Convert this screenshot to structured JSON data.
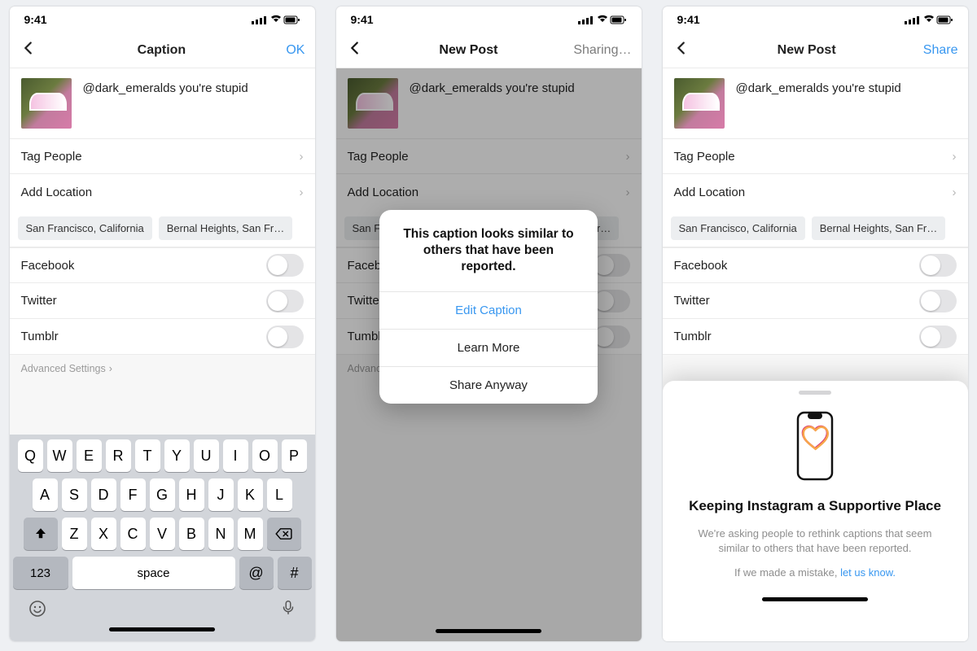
{
  "status": {
    "time": "9:41"
  },
  "s1": {
    "title": "Caption",
    "action": "OK",
    "caption": "@dark_emeralds you're stupid",
    "rows": {
      "tag": "Tag People",
      "loc": "Add Location"
    },
    "pills": [
      "San Francisco, California",
      "Bernal Heights, San Fr…"
    ],
    "shares": [
      "Facebook",
      "Twitter",
      "Tumblr"
    ],
    "adv": "Advanced Settings",
    "kb": {
      "r1": [
        "Q",
        "W",
        "E",
        "R",
        "T",
        "Y",
        "U",
        "I",
        "O",
        "P"
      ],
      "r2": [
        "A",
        "S",
        "D",
        "F",
        "G",
        "H",
        "J",
        "K",
        "L"
      ],
      "r3": [
        "Z",
        "X",
        "C",
        "V",
        "B",
        "N",
        "M"
      ],
      "num": "123",
      "space": "space",
      "at": "@",
      "hash": "#"
    }
  },
  "s2": {
    "title": "New Post",
    "action": "Sharing…",
    "alert": {
      "msg": "This caption looks similar to others that have been reported.",
      "b1": "Edit Caption",
      "b2": "Learn More",
      "b3": "Share Anyway"
    }
  },
  "s3": {
    "title": "New Post",
    "action": "Share",
    "sheet": {
      "h": "Keeping Instagram a Supportive Place",
      "p": "We're asking people to rethink captions that seem similar to others that have been reported.",
      "p2a": "If we made a mistake, ",
      "p2b": "let us know."
    }
  }
}
